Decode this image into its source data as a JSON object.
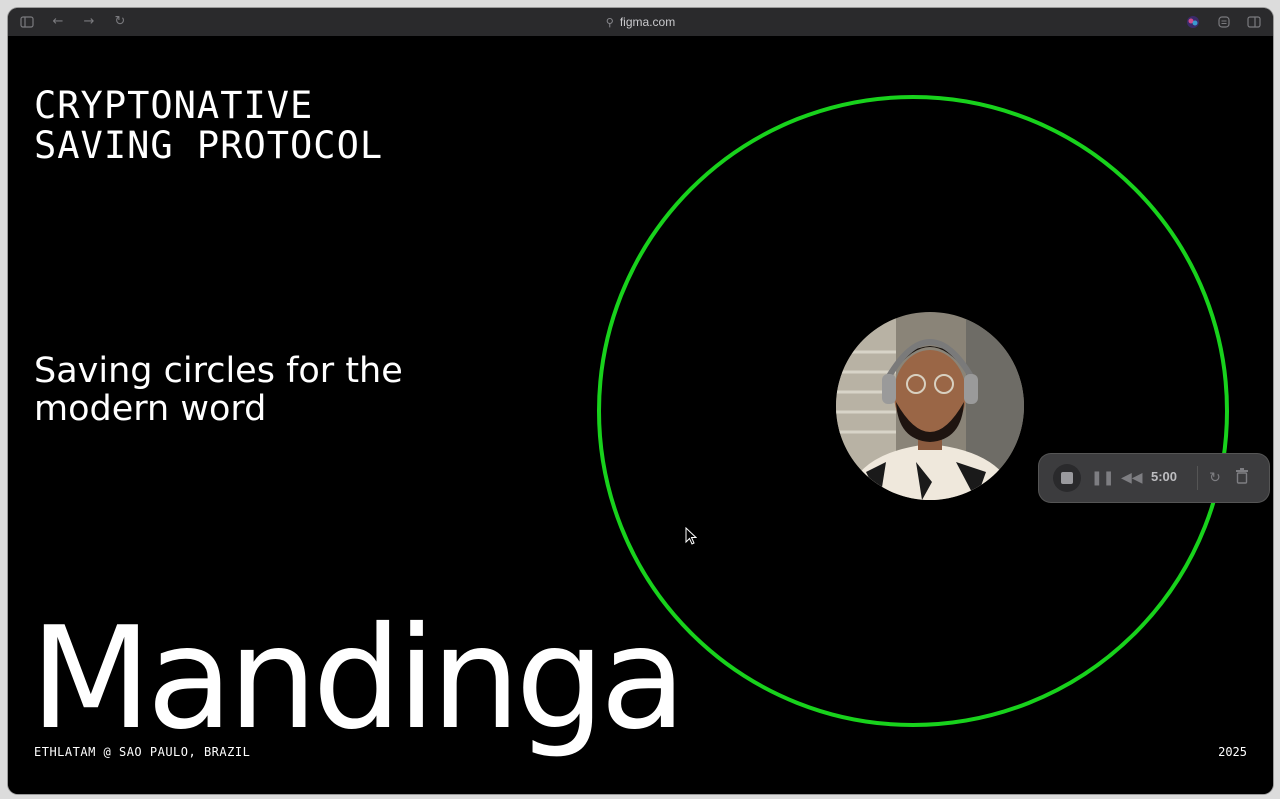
{
  "browser": {
    "url": "figma.com",
    "icons": [
      "sidebar-icon",
      "back-icon",
      "forward-icon",
      "reload-icon",
      "link-icon",
      "extension-icon",
      "share-icon",
      "split-view-icon"
    ]
  },
  "slide": {
    "subtitle": "CRYPTONATIVE\nSAVING PROTOCOL",
    "tagline": "Saving circles for the\nmodern word",
    "brand": "Mandinga",
    "event": "ETHLATAM @ SAO PAULO, BRAZIL",
    "year": "2025",
    "ring_color": "#18d21c"
  },
  "recorder": {
    "time": "5:00",
    "icons": [
      "stop-icon",
      "pause-icon",
      "rewind-icon",
      "restart-icon",
      "trash-icon"
    ]
  }
}
